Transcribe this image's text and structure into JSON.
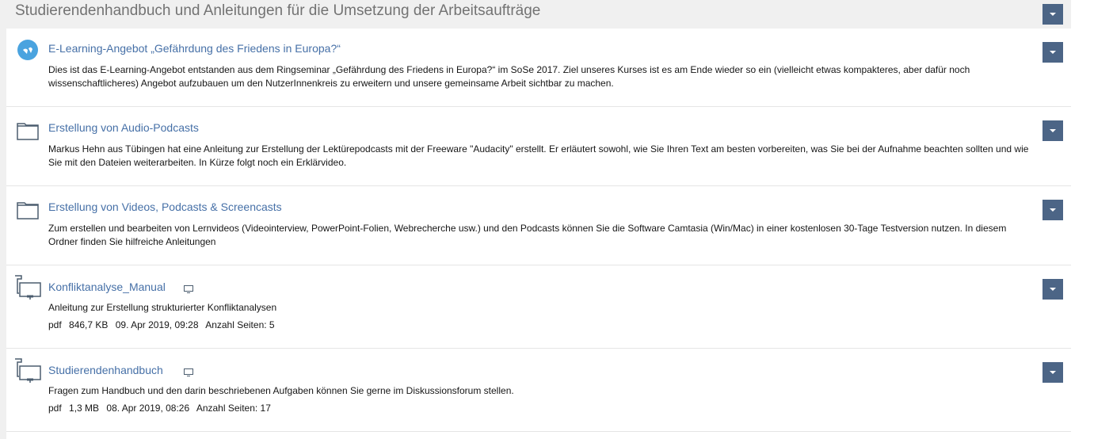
{
  "block": {
    "title": "Studierendenhandbuch und Anleitungen für die Umsetzung der Arbeitsaufträge",
    "actions_icon": "chevron-down-icon"
  },
  "items": [
    {
      "type": "learning-module",
      "icon": "learning-module-icon",
      "title": "E-Learning-Angebot „Gefährdung des Friedens in Europa?“",
      "description": "Dies ist das E-Learning-Angebot entstanden aus dem Ringseminar „Gefährdung des Friedens in Europa?“ im SoSe 2017. Ziel unseres Kurses ist es am Ende wieder so ein (vielleicht etwas kompakteres, aber dafür noch wissenschaftlicheres) Angebot aufzubauen um den NutzerInnenkreis zu erweitern und unsere gemeinsame Arbeit sichtbar zu machen."
    },
    {
      "type": "folder",
      "icon": "folder-icon",
      "title": "Erstellung von Audio-Podcasts",
      "description": "Markus Hehn aus Tübingen hat eine Anleitung zur Erstellung der Lektürepodcasts mit der Freeware \"Audacity\" erstellt. Er erläutert sowohl, wie Sie Ihren Text am besten vorbereiten, was Sie bei der Aufnahme beachten sollten und wie Sie mit den Dateien weiterarbeiten. In Kürze folgt noch ein Erklärvideo."
    },
    {
      "type": "folder",
      "icon": "folder-icon",
      "title": "Erstellung von Videos, Podcasts & Screencasts",
      "description": "Zum erstellen und bearbeiten von Lernvideos (Videointerview, PowerPoint-Folien, Webrecherche usw.) und den Podcasts können Sie die Software Camtasia (Win/Mac) in einer kostenlosen 30-Tage Testversion nutzen. In diesem Ordner finden Sie hilfreiche Anleitungen"
    },
    {
      "type": "file",
      "icon": "file-icon",
      "preview_icon": "preview-monitor-icon",
      "title": "Konfliktanalyse_Manual",
      "description": "Anleitung zur Erstellung strukturierter Konfliktanalysen",
      "meta": {
        "format": "pdf",
        "size": "846,7 KB",
        "date": "09. Apr 2019, 09:28",
        "pages": "Anzahl Seiten: 5"
      }
    },
    {
      "type": "file",
      "icon": "file-icon",
      "preview_icon": "preview-monitor-icon",
      "title": "Studierendenhandbuch",
      "description": "Fragen zum Handbuch und den darin beschriebenen Aufgaben können Sie gerne im Diskussionsforum stellen.",
      "meta": {
        "format": "pdf",
        "size": "1,3 MB",
        "date": "08. Apr 2019, 08:26",
        "pages": "Anzahl Seiten: 17"
      }
    }
  ],
  "colors": {
    "panel_bg": "#f0f0f0",
    "link": "#4670a7",
    "button": "#4c6586",
    "module_icon": "#4aa3df",
    "icon_stroke": "#4b5d6f"
  }
}
